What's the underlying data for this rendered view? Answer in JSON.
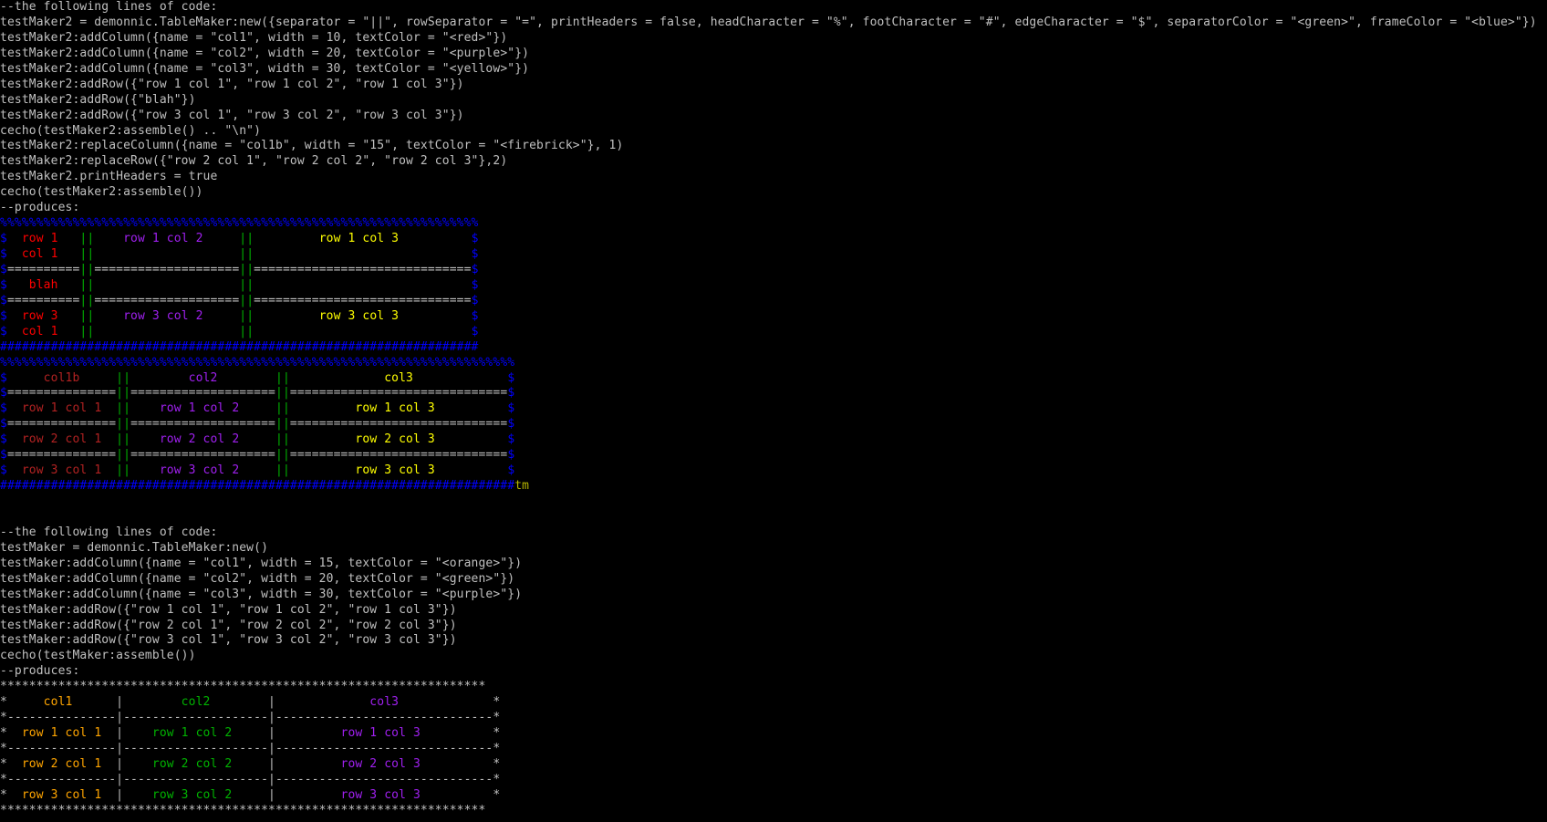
{
  "window": {
    "app": "Mudlet console"
  },
  "colors": {
    "default": "#c0c0c0",
    "red": "#ff0000",
    "purple": "#a020f0",
    "yellow": "#ffff00",
    "green": "#00b300",
    "blue": "#0000ff",
    "firebrick": "#b22222",
    "orange": "#ffa500",
    "olive": "#b3b300"
  },
  "console": {
    "lines": [
      [
        [
          "--the following lines of code:",
          "default"
        ]
      ],
      [
        [
          "testMaker2 = demonnic.TableMaker:new({separator = \"||\", rowSeparator = \"=\", printHeaders = false, headCharacter = \"%\", footCharacter = \"#\", edgeCharacter = \"$\", separatorColor = \"<green>\", frameColor = \"<blue>\"})",
          "default"
        ]
      ],
      [
        [
          "testMaker2:addColumn({name = \"col1\", width = 10, textColor = \"<red>\"})",
          "default"
        ]
      ],
      [
        [
          "testMaker2:addColumn({name = \"col2\", width = 20, textColor = \"<purple>\"})",
          "default"
        ]
      ],
      [
        [
          "testMaker2:addColumn({name = \"col3\", width = 30, textColor = \"<yellow>\"})",
          "default"
        ]
      ],
      [
        [
          "testMaker2:addRow({\"row 1 col 1\", \"row 1 col 2\", \"row 1 col 3\"})",
          "default"
        ]
      ],
      [
        [
          "testMaker2:addRow({\"blah\"})",
          "default"
        ]
      ],
      [
        [
          "testMaker2:addRow({\"row 3 col 1\", \"row 3 col 2\", \"row 3 col 3\"})",
          "default"
        ]
      ],
      [
        [
          "cecho(testMaker2:assemble() .. \"\\n\")",
          "default"
        ]
      ],
      [
        [
          "testMaker2:replaceColumn({name = \"col1b\", width = \"15\", textColor = \"<firebrick>\"}, 1)",
          "default"
        ]
      ],
      [
        [
          "testMaker2:replaceRow({\"row 2 col 1\", \"row 2 col 2\", \"row 2 col 3\"},2)",
          "default"
        ]
      ],
      [
        [
          "testMaker2.printHeaders = true",
          "default"
        ]
      ],
      [
        [
          "cecho(testMaker2:assemble())",
          "default"
        ]
      ],
      [
        [
          "--produces:",
          "default"
        ]
      ],
      [
        [
          "%%%%%%%%%%%%%%%%%%%%%%%%%%%%%%%%%%%%%%%%%%%%%%%%%%%%%%%%%%%%%%%%%%",
          "blue"
        ]
      ],
      [
        [
          "$",
          "blue"
        ],
        [
          "  row 1   ",
          "red"
        ],
        [
          "||",
          "green"
        ],
        [
          "    row 1 col 2     ",
          "purple"
        ],
        [
          "||",
          "green"
        ],
        [
          "         row 1 col 3          ",
          "yellow"
        ],
        [
          "$",
          "blue"
        ]
      ],
      [
        [
          "$",
          "blue"
        ],
        [
          "  col 1   ",
          "red"
        ],
        [
          "||",
          "green"
        ],
        [
          "                    ",
          "purple"
        ],
        [
          "||",
          "green"
        ],
        [
          "                              ",
          "yellow"
        ],
        [
          "$",
          "blue"
        ]
      ],
      [
        [
          "$",
          "blue"
        ],
        [
          "==========",
          "default"
        ],
        [
          "||",
          "green"
        ],
        [
          "====================",
          "default"
        ],
        [
          "||",
          "green"
        ],
        [
          "==============================",
          "default"
        ],
        [
          "$",
          "blue"
        ]
      ],
      [
        [
          "$",
          "blue"
        ],
        [
          "   blah   ",
          "red"
        ],
        [
          "||",
          "green"
        ],
        [
          "                    ",
          "purple"
        ],
        [
          "||",
          "green"
        ],
        [
          "                              ",
          "yellow"
        ],
        [
          "$",
          "blue"
        ]
      ],
      [
        [
          "$",
          "blue"
        ],
        [
          "==========",
          "default"
        ],
        [
          "||",
          "green"
        ],
        [
          "====================",
          "default"
        ],
        [
          "||",
          "green"
        ],
        [
          "==============================",
          "default"
        ],
        [
          "$",
          "blue"
        ]
      ],
      [
        [
          "$",
          "blue"
        ],
        [
          "  row 3   ",
          "red"
        ],
        [
          "||",
          "green"
        ],
        [
          "    row 3 col 2     ",
          "purple"
        ],
        [
          "||",
          "green"
        ],
        [
          "         row 3 col 3          ",
          "yellow"
        ],
        [
          "$",
          "blue"
        ]
      ],
      [
        [
          "$",
          "blue"
        ],
        [
          "  col 1   ",
          "red"
        ],
        [
          "||",
          "green"
        ],
        [
          "                    ",
          "purple"
        ],
        [
          "||",
          "green"
        ],
        [
          "                              ",
          "yellow"
        ],
        [
          "$",
          "blue"
        ]
      ],
      [
        [
          "##################################################################",
          "blue"
        ]
      ],
      [
        [
          "%%%%%%%%%%%%%%%%%%%%%%%%%%%%%%%%%%%%%%%%%%%%%%%%%%%%%%%%%%%%%%%%%%%%%%%",
          "blue"
        ]
      ],
      [
        [
          "$",
          "blue"
        ],
        [
          "     col1b     ",
          "firebrick"
        ],
        [
          "||",
          "green"
        ],
        [
          "        col2        ",
          "purple"
        ],
        [
          "||",
          "green"
        ],
        [
          "             col3             ",
          "yellow"
        ],
        [
          "$",
          "blue"
        ]
      ],
      [
        [
          "$",
          "blue"
        ],
        [
          "===============",
          "default"
        ],
        [
          "||",
          "green"
        ],
        [
          "====================",
          "default"
        ],
        [
          "||",
          "green"
        ],
        [
          "==============================",
          "default"
        ],
        [
          "$",
          "blue"
        ]
      ],
      [
        [
          "$",
          "blue"
        ],
        [
          "  row 1 col 1  ",
          "firebrick"
        ],
        [
          "||",
          "green"
        ],
        [
          "    row 1 col 2     ",
          "purple"
        ],
        [
          "||",
          "green"
        ],
        [
          "         row 1 col 3          ",
          "yellow"
        ],
        [
          "$",
          "blue"
        ]
      ],
      [
        [
          "$",
          "blue"
        ],
        [
          "===============",
          "default"
        ],
        [
          "||",
          "green"
        ],
        [
          "====================",
          "default"
        ],
        [
          "||",
          "green"
        ],
        [
          "==============================",
          "default"
        ],
        [
          "$",
          "blue"
        ]
      ],
      [
        [
          "$",
          "blue"
        ],
        [
          "  row 2 col 1  ",
          "firebrick"
        ],
        [
          "||",
          "green"
        ],
        [
          "    row 2 col 2     ",
          "purple"
        ],
        [
          "||",
          "green"
        ],
        [
          "         row 2 col 3          ",
          "yellow"
        ],
        [
          "$",
          "blue"
        ]
      ],
      [
        [
          "$",
          "blue"
        ],
        [
          "===============",
          "default"
        ],
        [
          "||",
          "green"
        ],
        [
          "====================",
          "default"
        ],
        [
          "||",
          "green"
        ],
        [
          "==============================",
          "default"
        ],
        [
          "$",
          "blue"
        ]
      ],
      [
        [
          "$",
          "blue"
        ],
        [
          "  row 3 col 1  ",
          "firebrick"
        ],
        [
          "||",
          "green"
        ],
        [
          "    row 3 col 2     ",
          "purple"
        ],
        [
          "||",
          "green"
        ],
        [
          "         row 3 col 3          ",
          "yellow"
        ],
        [
          "$",
          "blue"
        ]
      ],
      [
        [
          "#######################################################################",
          "blue"
        ],
        [
          "tm",
          "olive"
        ]
      ],
      [],
      [],
      [
        [
          "--the following lines of code:",
          "default"
        ]
      ],
      [
        [
          "testMaker = demonnic.TableMaker:new()",
          "default"
        ]
      ],
      [
        [
          "testMaker:addColumn({name = \"col1\", width = 15, textColor = \"<orange>\"})",
          "default"
        ]
      ],
      [
        [
          "testMaker:addColumn({name = \"col2\", width = 20, textColor = \"<green>\"})",
          "default"
        ]
      ],
      [
        [
          "testMaker:addColumn({name = \"col3\", width = 30, textColor = \"<purple>\"})",
          "default"
        ]
      ],
      [
        [
          "testMaker:addRow({\"row 1 col 1\", \"row 1 col 2\", \"row 1 col 3\"})",
          "default"
        ]
      ],
      [
        [
          "testMaker:addRow({\"row 2 col 1\", \"row 2 col 2\", \"row 2 col 3\"})",
          "default"
        ]
      ],
      [
        [
          "testMaker:addRow({\"row 3 col 1\", \"row 3 col 2\", \"row 3 col 3\"})",
          "default"
        ]
      ],
      [
        [
          "cecho(testMaker:assemble())",
          "default"
        ]
      ],
      [
        [
          "--produces:",
          "default"
        ]
      ],
      [
        [
          "*******************************************************************",
          "default"
        ]
      ],
      [
        [
          "*",
          "default"
        ],
        [
          "     col1      ",
          "orange"
        ],
        [
          "|",
          "default"
        ],
        [
          "        col2        ",
          "green"
        ],
        [
          "|",
          "default"
        ],
        [
          "             col3             ",
          "purple"
        ],
        [
          "*",
          "default"
        ]
      ],
      [
        [
          "*---------------|--------------------|------------------------------*",
          "default"
        ]
      ],
      [
        [
          "*",
          "default"
        ],
        [
          "  row 1 col 1  ",
          "orange"
        ],
        [
          "|",
          "default"
        ],
        [
          "    row 1 col 2     ",
          "green"
        ],
        [
          "|",
          "default"
        ],
        [
          "         row 1 col 3          ",
          "purple"
        ],
        [
          "*",
          "default"
        ]
      ],
      [
        [
          "*---------------|--------------------|------------------------------*",
          "default"
        ]
      ],
      [
        [
          "*",
          "default"
        ],
        [
          "  row 2 col 1  ",
          "orange"
        ],
        [
          "|",
          "default"
        ],
        [
          "    row 2 col 2     ",
          "green"
        ],
        [
          "|",
          "default"
        ],
        [
          "         row 2 col 3          ",
          "purple"
        ],
        [
          "*",
          "default"
        ]
      ],
      [
        [
          "*---------------|--------------------|------------------------------*",
          "default"
        ]
      ],
      [
        [
          "*",
          "default"
        ],
        [
          "  row 3 col 1  ",
          "orange"
        ],
        [
          "|",
          "default"
        ],
        [
          "    row 3 col 2     ",
          "green"
        ],
        [
          "|",
          "default"
        ],
        [
          "         row 3 col 3          ",
          "purple"
        ],
        [
          "*",
          "default"
        ]
      ],
      [
        [
          "*******************************************************************",
          "default"
        ]
      ]
    ]
  }
}
